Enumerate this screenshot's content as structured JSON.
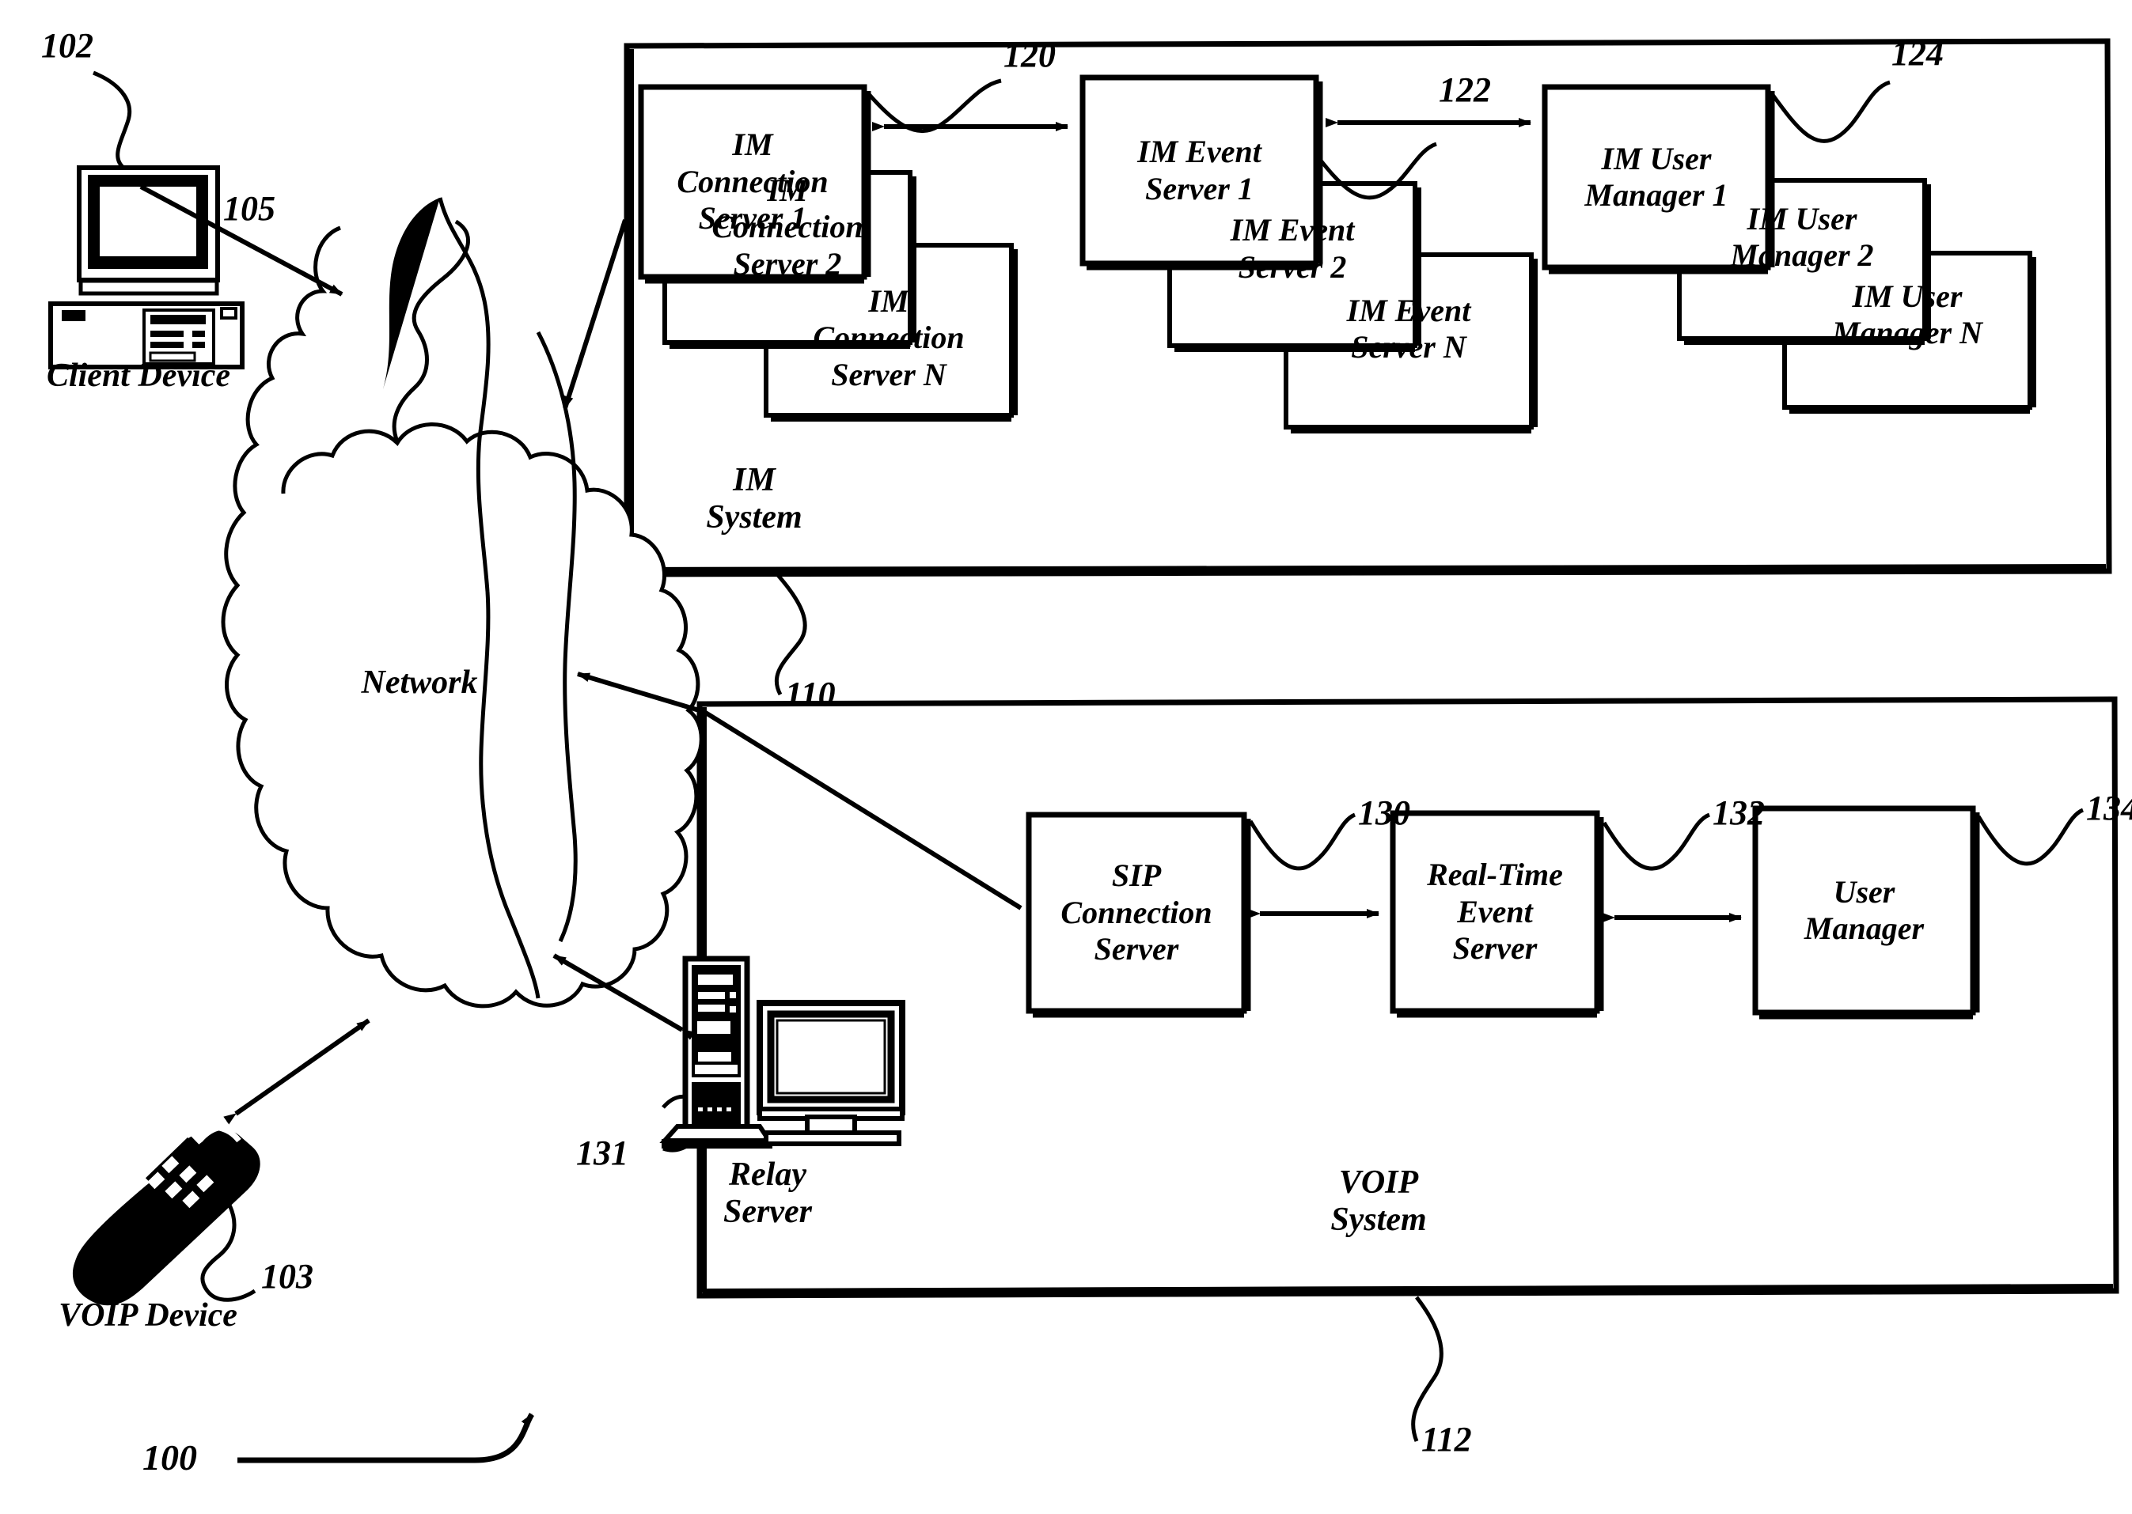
{
  "figure": {
    "number": "100",
    "kind": "patent-network-diagram"
  },
  "nodes": {
    "client_device": {
      "label": "Client Device",
      "ref": "102",
      "icon": "desktop-computer-icon"
    },
    "voip_device": {
      "label": "VOIP Device",
      "ref": "103",
      "icon": "mobile-phone-icon"
    },
    "network": {
      "label": "Network",
      "ref": "105",
      "icon": "cloud-icon"
    },
    "relay_server": {
      "label": "Relay\nServer",
      "ref": "131",
      "icon": "tower-server-icon"
    }
  },
  "im_system": {
    "title": "IM\nSystem",
    "ref": "110",
    "groups": [
      {
        "ref": "120",
        "name": "im-connection-server-stack",
        "boxes": [
          "IM\nConnection\nServer 1",
          "IM\nConnection\nServer 2",
          "IM\nConnection\nServer N"
        ]
      },
      {
        "ref": "122",
        "name": "im-event-server-stack",
        "boxes": [
          "IM Event\nServer 1",
          "IM Event\nServer 2",
          "IM Event\nServer N"
        ]
      },
      {
        "ref": "124",
        "name": "im-user-manager-stack",
        "boxes": [
          "IM User\nManager 1",
          "IM User\nManager 2",
          "IM User\nManager N"
        ]
      }
    ]
  },
  "voip_system": {
    "title": "VOIP\nSystem",
    "ref": "112",
    "boxes": [
      {
        "ref": "130",
        "name": "sip-connection-server",
        "label": "SIP\nConnection\nServer"
      },
      {
        "ref": "132",
        "name": "real-time-event-server",
        "label": "Real-Time\nEvent\nServer"
      },
      {
        "ref": "134",
        "name": "user-manager",
        "label": "User\nManager"
      }
    ]
  },
  "colors": {
    "stroke": "#000000",
    "fill": "#ffffff",
    "background": "#ffffff"
  }
}
